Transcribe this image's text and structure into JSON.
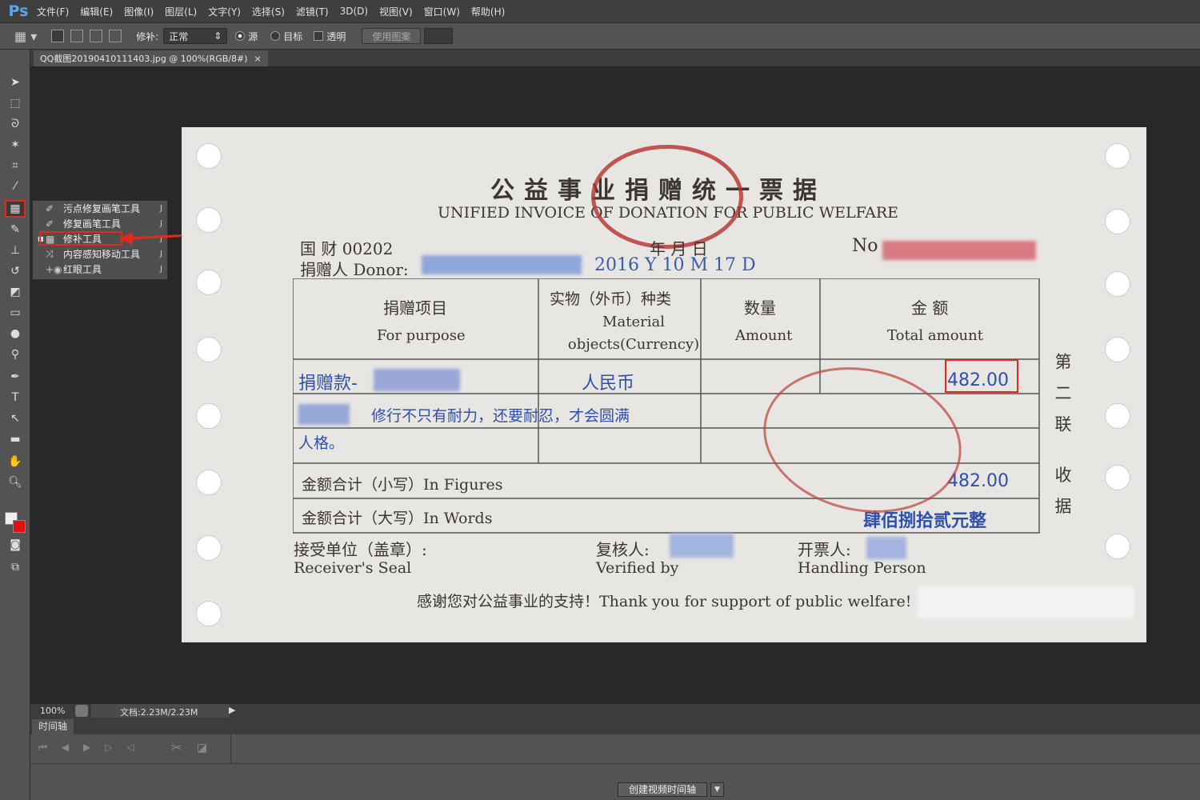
{
  "app": {
    "logo": "Ps"
  },
  "menu": [
    "文件(F)",
    "编辑(E)",
    "图像(I)",
    "图层(L)",
    "文字(Y)",
    "选择(S)",
    "滤镜(T)",
    "3D(D)",
    "视图(V)",
    "窗口(W)",
    "帮助(H)"
  ],
  "options": {
    "patch_label": "修补:",
    "patch_mode": "正常",
    "source": "源",
    "target": "目标",
    "transparent": "透明",
    "use_pattern": "使用图案",
    "selected_radio": "source"
  },
  "document_tab": {
    "title": "QQ截图20190410111403.jpg @ 100%(RGB/8#)",
    "close": "×"
  },
  "flyout": [
    {
      "label": "污点修复画笔工具",
      "shortcut": "J",
      "icon": "spot-healing-icon"
    },
    {
      "label": "修复画笔工具",
      "shortcut": "J",
      "icon": "healing-brush-icon"
    },
    {
      "label": "修补工具",
      "shortcut": "J",
      "icon": "patch-icon",
      "active": true
    },
    {
      "label": "内容感知移动工具",
      "shortcut": "J",
      "icon": "content-aware-move-icon"
    },
    {
      "label": "红眼工具",
      "shortcut": "J",
      "icon": "red-eye-icon"
    }
  ],
  "invoice": {
    "title_cn": "公益事业捐赠统一票据",
    "title_en": "UNIFIED INVOICE OF DONATION FOR PUBLIC WELFARE",
    "code": "国  财 00202",
    "date_labels": "年        月        日",
    "no_label": "No",
    "donor_label": "捐赠人 Donor:",
    "date_value": "2016  Y 10  M 17  D",
    "headers": [
      {
        "cn": "捐赠项目",
        "en": "For purpose"
      },
      {
        "cn": "实物（外币）种类",
        "en": "Material objects(Currency)"
      },
      {
        "cn": "数量",
        "en": "Amount"
      },
      {
        "cn": "金 额",
        "en": "Total amount"
      }
    ],
    "row1_purpose": "捐赠款-",
    "row1_currency": "人民币",
    "row1_amount": "482.00",
    "row2_text": "修行不只有耐力，还要耐忍，才会圆满",
    "row3_text": "人格。",
    "figures_label": "金额合计（小写）In Figures",
    "figures_value": "482.00",
    "words_label": "金额合计（大写）In Words",
    "words_value": "肆佰捌拾贰元整",
    "receiver_cn": "接受单位（盖章）:",
    "receiver_en": "Receiver's Seal",
    "verified_cn": "复核人:",
    "verified_en": "Verified by",
    "handler_cn": "开票人:",
    "handler_en": "Handling Person",
    "thanks": "感谢您对公益事业的支持！Thank you for support of public welfare!",
    "side_label": "第二联  收据"
  },
  "status": {
    "zoom": "100%",
    "doc": "文档:2.23M/2.23M"
  },
  "timeline": {
    "tab": "时间轴",
    "create_button": "创建视频时间轴"
  },
  "colors": {
    "highlight": "#e02a1a",
    "ps_blue": "#5ea6e8"
  }
}
